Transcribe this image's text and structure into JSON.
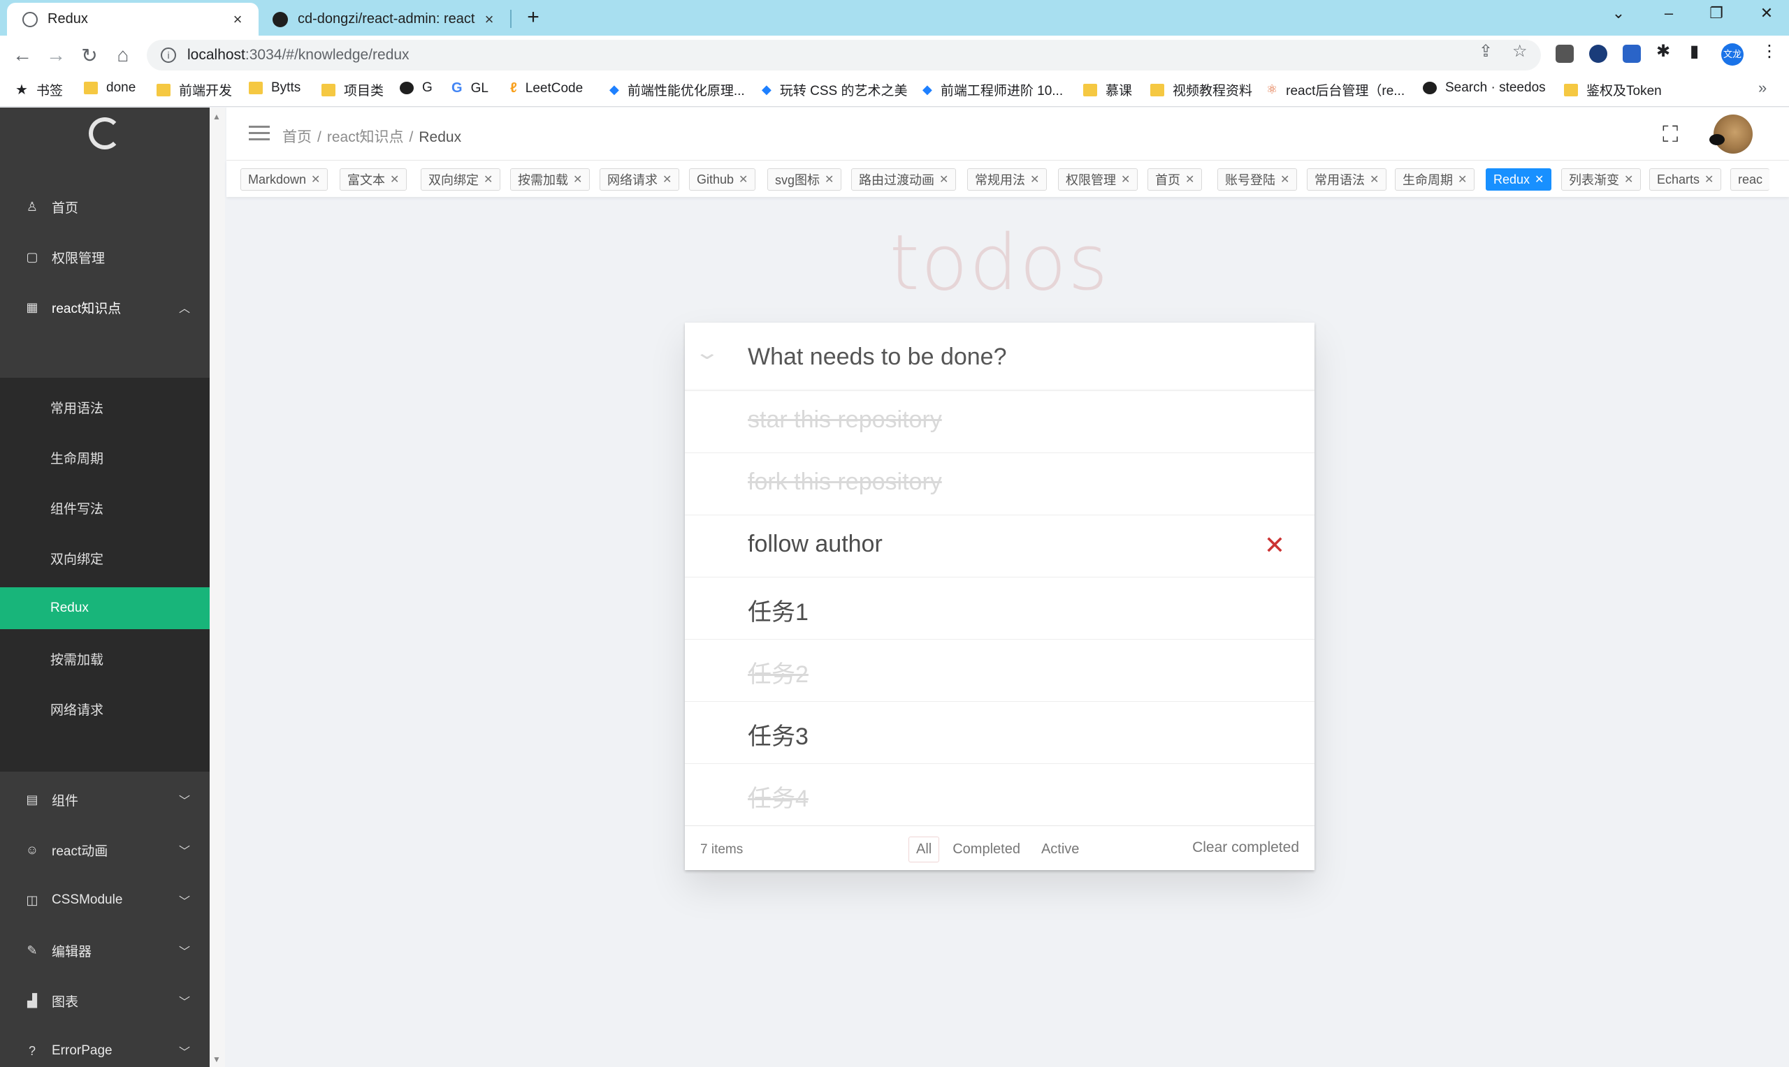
{
  "browser": {
    "tabs": [
      {
        "title": "Redux",
        "active": true
      },
      {
        "title": "cd-dongzi/react-admin: react",
        "active": false
      }
    ],
    "address": {
      "host": "localhost",
      "rest": ":3034/#/knowledge/redux"
    },
    "profile_initials": "文龙",
    "bookmarks": [
      {
        "label": "书签",
        "icon": "star"
      },
      {
        "label": "done",
        "icon": "folder"
      },
      {
        "label": "前端开发",
        "icon": "folder"
      },
      {
        "label": "Bytts",
        "icon": "folder"
      },
      {
        "label": "项目类",
        "icon": "folder"
      },
      {
        "label": "G",
        "icon": "github"
      },
      {
        "label": "GL",
        "icon": "google"
      },
      {
        "label": "LeetCode",
        "icon": "leetcode"
      },
      {
        "label": "前端性能优化原理...",
        "icon": "juejin"
      },
      {
        "label": "玩转 CSS 的艺术之美",
        "icon": "juejin"
      },
      {
        "label": "前端工程师进阶 10...",
        "icon": "juejin"
      },
      {
        "label": "慕课",
        "icon": "folder"
      },
      {
        "label": "视频教程资料",
        "icon": "folder"
      },
      {
        "label": "react后台管理（re...",
        "icon": "react"
      },
      {
        "label": "Search · steedos",
        "icon": "github"
      },
      {
        "label": "鉴权及Token",
        "icon": "folder"
      }
    ]
  },
  "sidebar": {
    "items": [
      {
        "label": "首页",
        "icon": "user-icon"
      },
      {
        "label": "权限管理",
        "icon": "lock-icon"
      },
      {
        "label": "react知识点",
        "icon": "calendar-icon",
        "expanded": true
      },
      {
        "label": "组件",
        "icon": "list-icon"
      },
      {
        "label": "react动画",
        "icon": "smile-icon"
      },
      {
        "label": "CSSModule",
        "icon": "layout-icon"
      },
      {
        "label": "编辑器",
        "icon": "edit-icon"
      },
      {
        "label": "图表",
        "icon": "chart-icon"
      },
      {
        "label": "ErrorPage",
        "icon": "question-icon"
      }
    ],
    "submenu": [
      "常用语法",
      "生命周期",
      "组件写法",
      "双向绑定",
      "Redux",
      "按需加载",
      "网络请求"
    ],
    "active_sub": "Redux"
  },
  "header": {
    "breadcrumb": [
      "首页",
      "react知识点",
      "Redux"
    ]
  },
  "tags": [
    "Markdown",
    "富文本",
    "双向绑定",
    "按需加载",
    "网络请求",
    "Github",
    "svg图标",
    "路由过渡动画",
    "常规用法",
    "权限管理",
    "首页",
    "账号登陆",
    "常用语法",
    "生命周期",
    "Redux",
    "列表渐变",
    "Echarts",
    "reac"
  ],
  "active_tag": "Redux",
  "todo": {
    "title": "todos",
    "placeholder": "What needs to be done?",
    "items": [
      {
        "text": "star this repository",
        "completed": true
      },
      {
        "text": "fork this repository",
        "completed": true
      },
      {
        "text": "follow author",
        "completed": false
      },
      {
        "text": "任务1",
        "completed": false
      },
      {
        "text": "任务2",
        "completed": true
      },
      {
        "text": "任务3",
        "completed": false
      },
      {
        "text": "任务4",
        "completed": true
      }
    ],
    "count_label": "7 items",
    "filters": [
      "All",
      "Completed",
      "Active"
    ],
    "selected_filter": "All",
    "clear_label": "Clear completed"
  },
  "colors": {
    "sidebar_bg": "#3b3b3b",
    "submenu_bg": "#2a2a2a",
    "active_green": "#18b57a",
    "tag_active_blue": "#1890ff",
    "destroy_red": "#cc3333"
  }
}
